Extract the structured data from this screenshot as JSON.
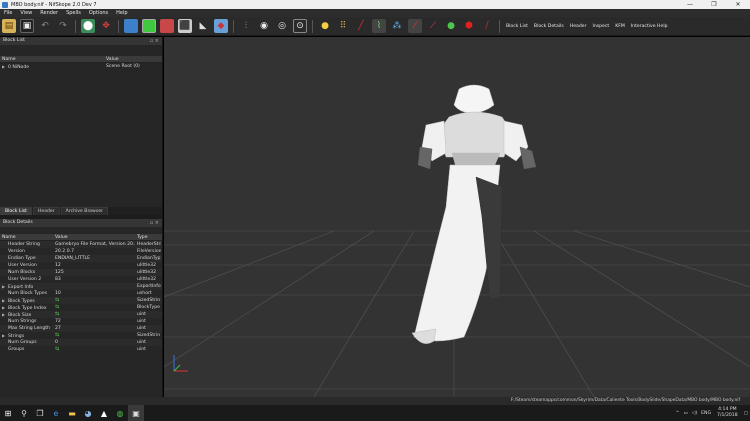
{
  "window": {
    "title": "MBO body.nif - NifSkope 2.0 Dev 7",
    "controls": [
      "—",
      "❐",
      "✕"
    ]
  },
  "menu": [
    "File",
    "View",
    "Render",
    "Spells",
    "Options",
    "Help"
  ],
  "toolbar_links": [
    "Block List",
    "Block Details",
    "Header",
    "Inspect",
    "KFM",
    "Interactive Help"
  ],
  "block_list": {
    "title": "Block List",
    "columns": [
      "Name",
      "Value"
    ],
    "rows": [
      {
        "name": "0 NiNode",
        "value": "Scene Root (0)"
      }
    ]
  },
  "tabs": [
    "Block List",
    "Header",
    "Archive Browser"
  ],
  "block_details": {
    "title": "Block Details",
    "columns": [
      "Name",
      "Value",
      "Type"
    ],
    "rows": [
      {
        "name": "Header String",
        "value": "Gamebryo File Format, Version 20.2....",
        "type": "HeaderStri",
        "expand": false,
        "check": false
      },
      {
        "name": "Version",
        "value": "20.2.0.7",
        "type": "FileVersion",
        "expand": false,
        "check": false
      },
      {
        "name": "Endian Type",
        "value": "ENDIAN_LITTLE",
        "type": "EndianTyp",
        "expand": false,
        "check": false
      },
      {
        "name": "User Version",
        "value": "12",
        "type": "ulittle32",
        "expand": false,
        "check": false
      },
      {
        "name": "Num Blocks",
        "value": "125",
        "type": "ulittle32",
        "expand": false,
        "check": false
      },
      {
        "name": "User Version 2",
        "value": "83",
        "type": "ulittle32",
        "expand": false,
        "check": false
      },
      {
        "name": "Export Info",
        "value": "",
        "type": "ExportInfo",
        "expand": true,
        "check": false
      },
      {
        "name": "Num Block Types",
        "value": "10",
        "type": "ushort",
        "expand": false,
        "check": false
      },
      {
        "name": "Block Types",
        "value": "",
        "type": "SizedStrin",
        "expand": true,
        "check": true
      },
      {
        "name": "Block Type Index",
        "value": "",
        "type": "BlockType",
        "expand": true,
        "check": true
      },
      {
        "name": "Block Size",
        "value": "",
        "type": "uint",
        "expand": true,
        "check": true
      },
      {
        "name": "Num Strings",
        "value": "72",
        "type": "uint",
        "expand": false,
        "check": false
      },
      {
        "name": "Max String Length",
        "value": "27",
        "type": "uint",
        "expand": false,
        "check": false
      },
      {
        "name": "Strings",
        "value": "",
        "type": "SizedStrin",
        "expand": true,
        "check": true
      },
      {
        "name": "Num Groups",
        "value": "0",
        "type": "uint",
        "expand": false,
        "check": false
      },
      {
        "name": "Groups",
        "value": "",
        "type": "uint",
        "expand": false,
        "check": true
      }
    ]
  },
  "status_path": "F:/Steam/steamapps/common/Skyrim/Data/Caliente Tools/BodySlide/ShapeData/MBO body/MBO body.nif",
  "tray": {
    "lang": "ENG",
    "time": "4:14 PM",
    "date": "7/1/2018"
  },
  "colors": {
    "viewport_bg": "#333333",
    "panel_bg": "#262626",
    "grid_line": "#555555"
  }
}
